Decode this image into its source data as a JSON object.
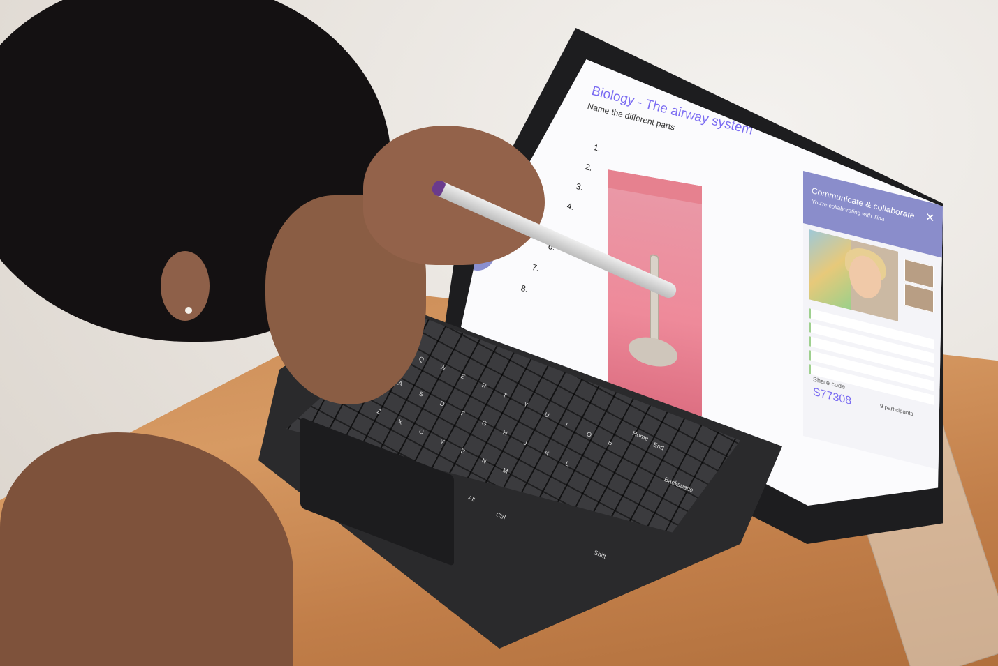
{
  "screen": {
    "slide_title": "Biology - The airway system",
    "slide_subtitle": "Name the different parts",
    "numbers": [
      "1.",
      "2.",
      "3.",
      "4.",
      "6.",
      "7.",
      "8."
    ]
  },
  "collab": {
    "title": "Communicate & collaborate",
    "subtitle": "You're collaborating with Tina",
    "close_label": "✕",
    "participants": [
      "",
      "",
      "",
      "",
      "",
      ""
    ],
    "share_label": "Share code",
    "share_code": "S77308",
    "participants_count": "9 participants"
  },
  "keyboard": {
    "keys": [
      "Q",
      "W",
      "E",
      "R",
      "T",
      "Y",
      "U",
      "I",
      "O",
      "P",
      "A",
      "S",
      "D",
      "F",
      "G",
      "H",
      "J",
      "K",
      "L",
      "Z",
      "X",
      "C",
      "V",
      "B",
      "N",
      "M",
      "Home",
      "End",
      "Shift",
      "Ctrl",
      "Alt",
      "Backspace"
    ]
  },
  "colors": {
    "accent": "#7b6cf2",
    "collab_header": "#8a8dcb",
    "card_pink": "#ee8a9a",
    "desk": "#d79a63"
  }
}
